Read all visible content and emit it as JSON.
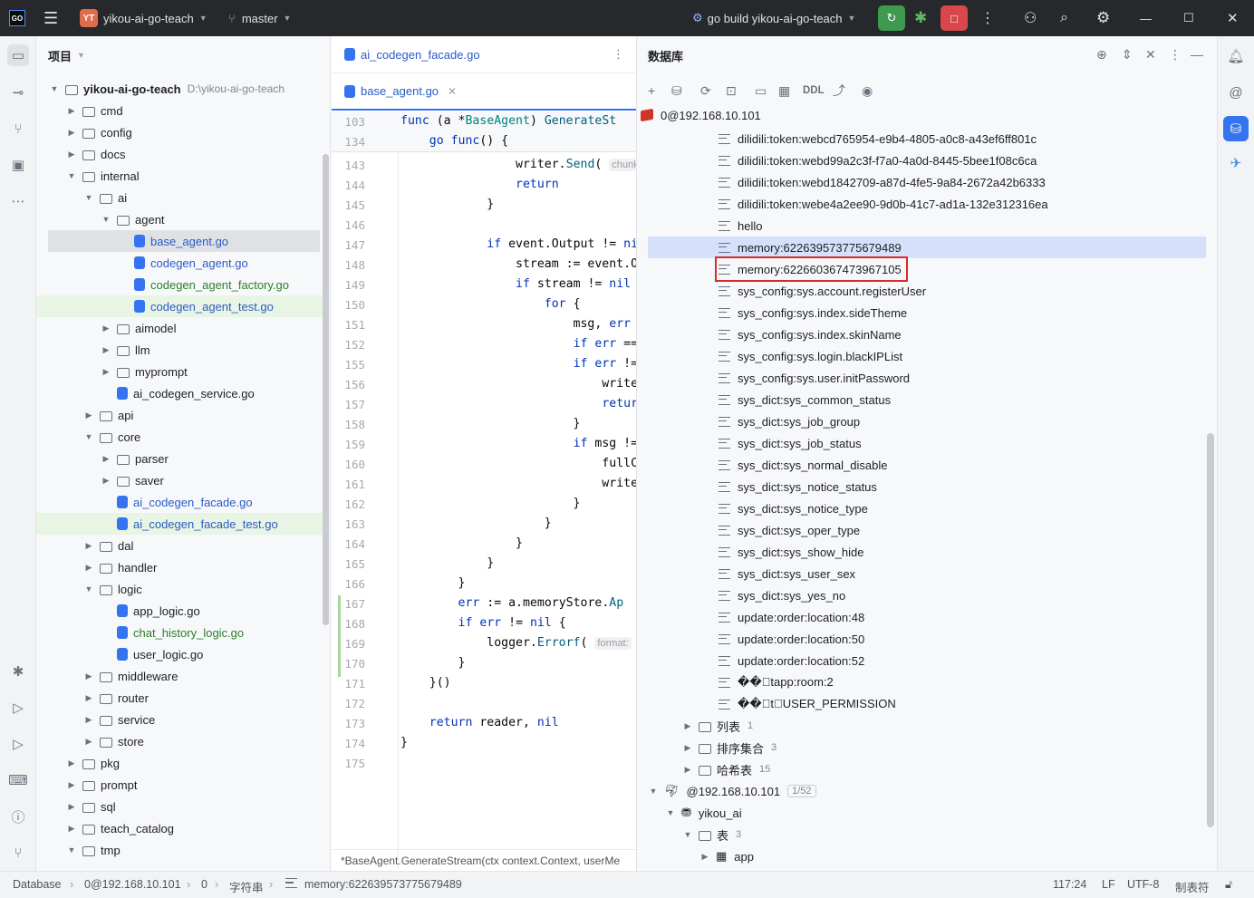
{
  "titlebar": {
    "logo": "GO",
    "project_badge": "YT",
    "project_name": "yikou-ai-go-teach",
    "branch": "master",
    "run_config": "go build yikou-ai-go-teach",
    "icons": [
      "hamburger-menu-icon",
      "branch-icon",
      "run-icon",
      "debug-icon",
      "stop-icon",
      "more-icon",
      "add-user-icon",
      "search-icon",
      "settings-icon",
      "minimize-icon",
      "maximize-icon",
      "close-icon"
    ]
  },
  "project_panel": {
    "title": "项目",
    "tree": [
      {
        "indent": 0,
        "expanded": true,
        "type": "folder",
        "name": "yikou-ai-go-teach",
        "path": "D:\\yikou-ai-go-teach",
        "bold": true
      },
      {
        "indent": 1,
        "expanded": false,
        "type": "folder",
        "name": "cmd"
      },
      {
        "indent": 1,
        "expanded": false,
        "type": "folder",
        "name": "config"
      },
      {
        "indent": 1,
        "expanded": false,
        "type": "folder",
        "name": "docs"
      },
      {
        "indent": 1,
        "expanded": true,
        "type": "folder",
        "name": "internal"
      },
      {
        "indent": 2,
        "expanded": true,
        "type": "folder",
        "name": "ai"
      },
      {
        "indent": 3,
        "expanded": true,
        "type": "folder",
        "name": "agent"
      },
      {
        "indent": 4,
        "type": "go",
        "name": "base_agent.go",
        "color": "blue",
        "selected": true
      },
      {
        "indent": 4,
        "type": "go",
        "name": "codegen_agent.go",
        "color": "blue"
      },
      {
        "indent": 4,
        "type": "go",
        "name": "codegen_agent_factory.go",
        "color": "green"
      },
      {
        "indent": 4,
        "type": "go",
        "name": "codegen_agent_test.go",
        "color": "blue",
        "green_bg": true
      },
      {
        "indent": 3,
        "expanded": false,
        "type": "folder",
        "name": "aimodel"
      },
      {
        "indent": 3,
        "expanded": false,
        "type": "folder",
        "name": "llm"
      },
      {
        "indent": 3,
        "expanded": false,
        "type": "folder",
        "name": "myprompt"
      },
      {
        "indent": 3,
        "type": "go",
        "name": "ai_codegen_service.go"
      },
      {
        "indent": 2,
        "expanded": false,
        "type": "folder",
        "name": "api"
      },
      {
        "indent": 2,
        "expanded": true,
        "type": "folder",
        "name": "core"
      },
      {
        "indent": 3,
        "expanded": false,
        "type": "folder",
        "name": "parser"
      },
      {
        "indent": 3,
        "expanded": false,
        "type": "folder",
        "name": "saver"
      },
      {
        "indent": 3,
        "type": "go",
        "name": "ai_codegen_facade.go",
        "color": "blue"
      },
      {
        "indent": 3,
        "type": "go",
        "name": "ai_codegen_facade_test.go",
        "color": "blue",
        "green_bg": true
      },
      {
        "indent": 2,
        "expanded": false,
        "type": "folder",
        "name": "dal"
      },
      {
        "indent": 2,
        "expanded": false,
        "type": "folder",
        "name": "handler"
      },
      {
        "indent": 2,
        "expanded": true,
        "type": "folder",
        "name": "logic"
      },
      {
        "indent": 3,
        "type": "go",
        "name": "app_logic.go"
      },
      {
        "indent": 3,
        "type": "go",
        "name": "chat_history_logic.go",
        "color": "green"
      },
      {
        "indent": 3,
        "type": "go",
        "name": "user_logic.go"
      },
      {
        "indent": 2,
        "expanded": false,
        "type": "folder",
        "name": "middleware"
      },
      {
        "indent": 2,
        "expanded": false,
        "type": "folder",
        "name": "router"
      },
      {
        "indent": 2,
        "expanded": false,
        "type": "folder",
        "name": "service"
      },
      {
        "indent": 2,
        "expanded": false,
        "type": "folder",
        "name": "store"
      },
      {
        "indent": 1,
        "expanded": false,
        "type": "folder",
        "name": "pkg"
      },
      {
        "indent": 1,
        "expanded": false,
        "type": "folder",
        "name": "prompt"
      },
      {
        "indent": 1,
        "expanded": false,
        "type": "folder",
        "name": "sql"
      },
      {
        "indent": 1,
        "expanded": false,
        "type": "folder",
        "name": "teach_catalog"
      },
      {
        "indent": 1,
        "expanded": true,
        "type": "folder",
        "name": "tmp"
      }
    ]
  },
  "editor": {
    "tabs": [
      {
        "name": "ai_codegen_facade.go",
        "active": false
      },
      {
        "name": "base_agent.go",
        "active": true
      }
    ],
    "sticky_lines": [
      {
        "ln": "103",
        "html": "<span class=\"kw\">func</span> (a *<span class=\"ty\">BaseAgent</span>) <span class=\"fn\">GenerateSt</span>"
      },
      {
        "ln": "134",
        "html": "    <span class=\"kw\">go func</span>() {"
      }
    ],
    "lines": [
      {
        "ln": "143",
        "html": "                writer.<span class=\"fn\">Send</span>( <span class=\"hint\">chunk</span>"
      },
      {
        "ln": "144",
        "html": "                <span class=\"kw\">return</span>"
      },
      {
        "ln": "145",
        "html": "            }"
      },
      {
        "ln": "146",
        "html": ""
      },
      {
        "ln": "147",
        "html": "            <span class=\"kw\">if</span> event.Output != <span class=\"kw\">ni</span>"
      },
      {
        "ln": "148",
        "html": "                stream := event.O"
      },
      {
        "ln": "149",
        "html": "                <span class=\"kw\">if</span> stream != <span class=\"kw\">nil</span>"
      },
      {
        "ln": "150",
        "html": "                    <span class=\"kw\">for</span> {"
      },
      {
        "ln": "151",
        "html": "                        msg, <span class=\"kw\">err</span>"
      },
      {
        "ln": "152",
        "html": "                        <span class=\"kw\">if</span> <span class=\"kw\">err</span> =="
      },
      {
        "ln": "155",
        "html": "                        <span class=\"kw\">if</span> <span class=\"kw\">err</span> !="
      },
      {
        "ln": "156",
        "html": "                            write"
      },
      {
        "ln": "157",
        "html": "                            <span class=\"kw\">retur</span>"
      },
      {
        "ln": "158",
        "html": "                        }"
      },
      {
        "ln": "159",
        "html": "                        <span class=\"kw\">if</span> msg !="
      },
      {
        "ln": "160",
        "html": "                            fullC"
      },
      {
        "ln": "161",
        "html": "                            write"
      },
      {
        "ln": "162",
        "html": "                        }"
      },
      {
        "ln": "163",
        "html": "                    }"
      },
      {
        "ln": "164",
        "html": "                }"
      },
      {
        "ln": "165",
        "html": "            }"
      },
      {
        "ln": "166",
        "html": "        }"
      },
      {
        "ln": "167",
        "html": "        <span class=\"kw\">err</span> := a.memoryStore.<span class=\"fn\">Ap</span>"
      },
      {
        "ln": "168",
        "html": "        <span class=\"kw\">if</span> <span class=\"kw\">err</span> != <span class=\"kw\">nil</span> {"
      },
      {
        "ln": "169",
        "html": "            logger.<span class=\"fn\">Errorf</span>( <span class=\"hint\">format:</span>"
      },
      {
        "ln": "170",
        "html": "        }"
      },
      {
        "ln": "171",
        "html": "    }()"
      },
      {
        "ln": "172",
        "html": ""
      },
      {
        "ln": "173",
        "html": "    <span class=\"kw\">return</span> reader, <span class=\"kw\">nil</span>"
      },
      {
        "ln": "174",
        "html": "}"
      },
      {
        "ln": "175",
        "html": ""
      }
    ],
    "status": "*BaseAgent.GenerateStream(ctx context.Context, userMe"
  },
  "database_panel": {
    "title": "数据库",
    "toolbar": [
      {
        "name": "add-icon",
        "glyph": "+"
      },
      {
        "name": "datasource-icon",
        "glyph": "⛁"
      },
      {
        "name": "refresh-icon",
        "glyph": "⟳"
      },
      {
        "name": "stop-icon",
        "glyph": "⊡"
      },
      {
        "name": "console-icon",
        "glyph": "▭"
      },
      {
        "name": "table-icon",
        "glyph": "▦"
      },
      {
        "name": "ddl-label",
        "glyph": "DDL"
      },
      {
        "name": "jump-icon",
        "glyph": "⤴"
      },
      {
        "name": "view-icon",
        "glyph": "◉"
      }
    ],
    "root": "0@192.168.10.101",
    "keys": [
      "dilidili:token:webcd765954-e9b4-4805-a0c8-a43ef6ff801c",
      "dilidili:token:webd99a2c3f-f7a0-4a0d-8445-5bee1f08c6ca",
      "dilidili:token:webd1842709-a87d-4fe5-9a84-2672a42b6333",
      "dilidili:token:webe4a2ee90-9d0b-41c7-ad1a-132e312316ea",
      "hello",
      "memory:622639573775679489",
      "memory:622660367473967105",
      "sys_config:sys.account.registerUser",
      "sys_config:sys.index.sideTheme",
      "sys_config:sys.index.skinName",
      "sys_config:sys.login.blackIPList",
      "sys_config:sys.user.initPassword",
      "sys_dict:sys_common_status",
      "sys_dict:sys_job_group",
      "sys_dict:sys_job_status",
      "sys_dict:sys_normal_disable",
      "sys_dict:sys_notice_status",
      "sys_dict:sys_notice_type",
      "sys_dict:sys_oper_type",
      "sys_dict:sys_show_hide",
      "sys_dict:sys_user_sex",
      "sys_dict:sys_yes_no",
      "update:order:location:48",
      "update:order:location:50",
      "update:order:location:52",
      "��\u0000tapp:room:2",
      "��\u0000t\u0000USER_PERMISSION"
    ],
    "selected_key": "memory:622639573775679489",
    "boxed_key": "memory:622660367473967105",
    "groups": [
      {
        "name": "列表",
        "count": "1"
      },
      {
        "name": "排序集合",
        "count": "3"
      },
      {
        "name": "哈希表",
        "count": "15"
      }
    ],
    "mysql": {
      "host": "@192.168.10.101",
      "badge": "1/52",
      "schema": "yikou_ai",
      "tables_label": "表",
      "tables_count": "3",
      "table": "app"
    }
  },
  "statusbar": {
    "items": [
      "Database",
      "0@192.168.10.101",
      "0",
      "字符串",
      "memory:622639573775679489"
    ],
    "position": "117:24",
    "line_sep": "LF",
    "encoding": "UTF-8",
    "indent": "制表符"
  }
}
